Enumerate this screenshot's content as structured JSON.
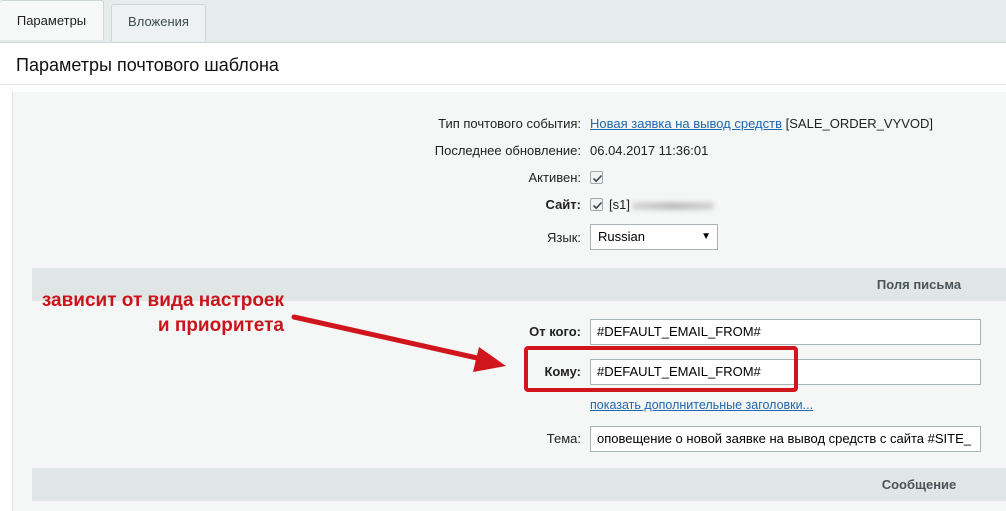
{
  "tabs": [
    {
      "label": "Параметры",
      "active": true
    },
    {
      "label": "Вложения",
      "active": false
    }
  ],
  "page_title": "Параметры почтового шаблона",
  "form": {
    "event_type": {
      "label": "Тип почтового события:",
      "link_text": "Новая заявка на вывод средств",
      "code": "[SALE_ORDER_VYVOD]"
    },
    "last_update": {
      "label": "Последнее обновление:",
      "value": "06.04.2017 11:36:01"
    },
    "active": {
      "label": "Активен:",
      "checked": true
    },
    "site": {
      "label": "Сайт:",
      "checked": true,
      "value": "[s1]"
    },
    "language": {
      "label": "Язык:",
      "selected": "Russian"
    }
  },
  "sections": {
    "letter_fields": "Поля письма",
    "message": "Сообщение"
  },
  "letter": {
    "from": {
      "label": "От кого:",
      "value": "#DEFAULT_EMAIL_FROM#"
    },
    "to": {
      "label": "Кому:",
      "value": "#DEFAULT_EMAIL_FROM#"
    },
    "show_headers_link": "показать дополнительные заголовки...",
    "subject": {
      "label": "Тема:",
      "value": "оповещение о новой заявке на вывод средств с сайта #SITE_"
    }
  },
  "annotation": {
    "line1": "зависит от вида настроек",
    "line2": "и приоритета",
    "color": "#c8141a"
  }
}
